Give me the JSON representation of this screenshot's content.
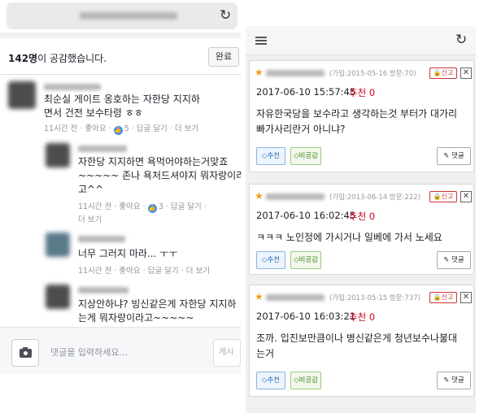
{
  "left_panel": {
    "reaction_count": "142명",
    "reaction_suffix": "이 공감했습니다.",
    "done_label": "완료",
    "comments": [
      {
        "lines": [
          "최순실 게이트 옹호하는 자한당 지지하",
          "면서 건전 보수타령 ㅎㅎ"
        ],
        "meta_prefix": "11시간 전 · 좋아요 ·",
        "likes": "5",
        "meta_suffix": "· 답글 달기 · 더 보기"
      },
      {
        "lines": [
          "자한당 지지하면 욕먹어야하는거맞죠",
          "~~~~~ 존나 욕처드셔야지 뭐자랑이라",
          "고^^"
        ],
        "meta_prefix": "11시간 전 · 좋아요 ·",
        "likes": "3",
        "meta_suffix": "· 답글 달기 ·",
        "meta_line2": "더 보기"
      },
      {
        "lines": [
          "너무 그러지 마라... ㅜㅜ"
        ],
        "meta": "11시간 전 · 좋아요 · 답글 달기 · 더 보기"
      },
      {
        "lines": [
          "지상안하냐? 빙신같은게 자한당 지지하",
          "는게 뭐자랑이라고~~~~~"
        ]
      }
    ],
    "input_placeholder": "댓글을 입력하세요...",
    "post_label": "게시"
  },
  "right_panel": {
    "recommend_label": "추천",
    "dislike_label": "비공감",
    "reply_label": "댓글",
    "report_label": "신고",
    "close_label": "✕",
    "cards": [
      {
        "joined": "(가입:2015-05-16 방문:70)",
        "date": "2017-06-10 15:57:45",
        "rec": "추천 0",
        "lines": [
          "자유한국당을 보수라고 생각하는것 부터가 대가리",
          "빠가사리란거 아니냐?"
        ]
      },
      {
        "joined": "(가입:2013-06-14 방문:222)",
        "date": "2017-06-10 16:02:45",
        "rec": "추천 0",
        "lines": [
          "ㅋㅋㅋ 노인정에 가시거나 일베에 가서 노세요"
        ]
      },
      {
        "joined": "(가입:2013-05-15 방문:737)",
        "date": "2017-06-10 16:03:21",
        "rec": "추천 0",
        "lines": [
          "조까. 입진보만큼이나 병신같은게 청년보수나불대",
          "는거"
        ]
      }
    ]
  },
  "colors": {
    "star": "#f39c12",
    "recommend_red": "#d0021b",
    "like_blue": "#4a90e2",
    "report_red": "#cc3333"
  }
}
